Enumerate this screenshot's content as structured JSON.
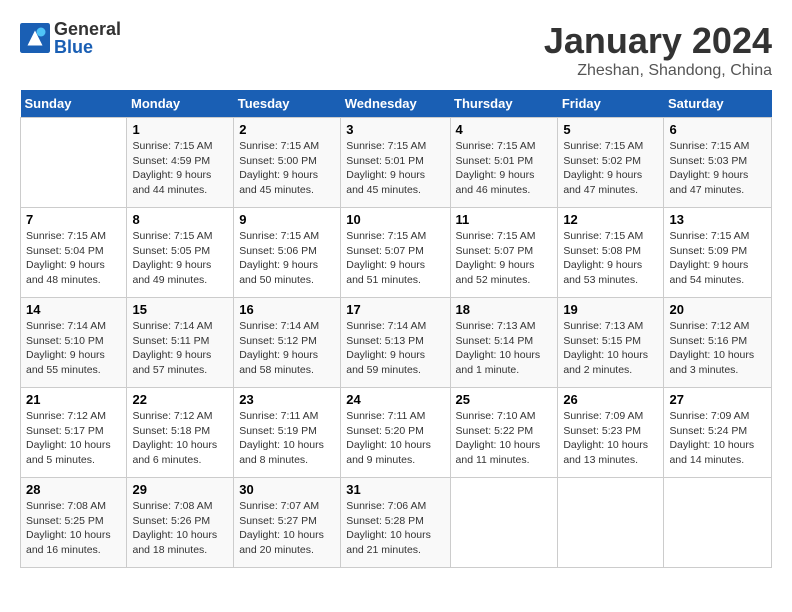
{
  "header": {
    "logo_general": "General",
    "logo_blue": "Blue",
    "month_title": "January 2024",
    "location": "Zheshan, Shandong, China"
  },
  "weekdays": [
    "Sunday",
    "Monday",
    "Tuesday",
    "Wednesday",
    "Thursday",
    "Friday",
    "Saturday"
  ],
  "weeks": [
    [
      {
        "day": "",
        "info": ""
      },
      {
        "day": "1",
        "info": "Sunrise: 7:15 AM\nSunset: 4:59 PM\nDaylight: 9 hours\nand 44 minutes."
      },
      {
        "day": "2",
        "info": "Sunrise: 7:15 AM\nSunset: 5:00 PM\nDaylight: 9 hours\nand 45 minutes."
      },
      {
        "day": "3",
        "info": "Sunrise: 7:15 AM\nSunset: 5:01 PM\nDaylight: 9 hours\nand 45 minutes."
      },
      {
        "day": "4",
        "info": "Sunrise: 7:15 AM\nSunset: 5:01 PM\nDaylight: 9 hours\nand 46 minutes."
      },
      {
        "day": "5",
        "info": "Sunrise: 7:15 AM\nSunset: 5:02 PM\nDaylight: 9 hours\nand 47 minutes."
      },
      {
        "day": "6",
        "info": "Sunrise: 7:15 AM\nSunset: 5:03 PM\nDaylight: 9 hours\nand 47 minutes."
      }
    ],
    [
      {
        "day": "7",
        "info": "Sunrise: 7:15 AM\nSunset: 5:04 PM\nDaylight: 9 hours\nand 48 minutes."
      },
      {
        "day": "8",
        "info": "Sunrise: 7:15 AM\nSunset: 5:05 PM\nDaylight: 9 hours\nand 49 minutes."
      },
      {
        "day": "9",
        "info": "Sunrise: 7:15 AM\nSunset: 5:06 PM\nDaylight: 9 hours\nand 50 minutes."
      },
      {
        "day": "10",
        "info": "Sunrise: 7:15 AM\nSunset: 5:07 PM\nDaylight: 9 hours\nand 51 minutes."
      },
      {
        "day": "11",
        "info": "Sunrise: 7:15 AM\nSunset: 5:07 PM\nDaylight: 9 hours\nand 52 minutes."
      },
      {
        "day": "12",
        "info": "Sunrise: 7:15 AM\nSunset: 5:08 PM\nDaylight: 9 hours\nand 53 minutes."
      },
      {
        "day": "13",
        "info": "Sunrise: 7:15 AM\nSunset: 5:09 PM\nDaylight: 9 hours\nand 54 minutes."
      }
    ],
    [
      {
        "day": "14",
        "info": "Sunrise: 7:14 AM\nSunset: 5:10 PM\nDaylight: 9 hours\nand 55 minutes."
      },
      {
        "day": "15",
        "info": "Sunrise: 7:14 AM\nSunset: 5:11 PM\nDaylight: 9 hours\nand 57 minutes."
      },
      {
        "day": "16",
        "info": "Sunrise: 7:14 AM\nSunset: 5:12 PM\nDaylight: 9 hours\nand 58 minutes."
      },
      {
        "day": "17",
        "info": "Sunrise: 7:14 AM\nSunset: 5:13 PM\nDaylight: 9 hours\nand 59 minutes."
      },
      {
        "day": "18",
        "info": "Sunrise: 7:13 AM\nSunset: 5:14 PM\nDaylight: 10 hours\nand 1 minute."
      },
      {
        "day": "19",
        "info": "Sunrise: 7:13 AM\nSunset: 5:15 PM\nDaylight: 10 hours\nand 2 minutes."
      },
      {
        "day": "20",
        "info": "Sunrise: 7:12 AM\nSunset: 5:16 PM\nDaylight: 10 hours\nand 3 minutes."
      }
    ],
    [
      {
        "day": "21",
        "info": "Sunrise: 7:12 AM\nSunset: 5:17 PM\nDaylight: 10 hours\nand 5 minutes."
      },
      {
        "day": "22",
        "info": "Sunrise: 7:12 AM\nSunset: 5:18 PM\nDaylight: 10 hours\nand 6 minutes."
      },
      {
        "day": "23",
        "info": "Sunrise: 7:11 AM\nSunset: 5:19 PM\nDaylight: 10 hours\nand 8 minutes."
      },
      {
        "day": "24",
        "info": "Sunrise: 7:11 AM\nSunset: 5:20 PM\nDaylight: 10 hours\nand 9 minutes."
      },
      {
        "day": "25",
        "info": "Sunrise: 7:10 AM\nSunset: 5:22 PM\nDaylight: 10 hours\nand 11 minutes."
      },
      {
        "day": "26",
        "info": "Sunrise: 7:09 AM\nSunset: 5:23 PM\nDaylight: 10 hours\nand 13 minutes."
      },
      {
        "day": "27",
        "info": "Sunrise: 7:09 AM\nSunset: 5:24 PM\nDaylight: 10 hours\nand 14 minutes."
      }
    ],
    [
      {
        "day": "28",
        "info": "Sunrise: 7:08 AM\nSunset: 5:25 PM\nDaylight: 10 hours\nand 16 minutes."
      },
      {
        "day": "29",
        "info": "Sunrise: 7:08 AM\nSunset: 5:26 PM\nDaylight: 10 hours\nand 18 minutes."
      },
      {
        "day": "30",
        "info": "Sunrise: 7:07 AM\nSunset: 5:27 PM\nDaylight: 10 hours\nand 20 minutes."
      },
      {
        "day": "31",
        "info": "Sunrise: 7:06 AM\nSunset: 5:28 PM\nDaylight: 10 hours\nand 21 minutes."
      },
      {
        "day": "",
        "info": ""
      },
      {
        "day": "",
        "info": ""
      },
      {
        "day": "",
        "info": ""
      }
    ]
  ]
}
